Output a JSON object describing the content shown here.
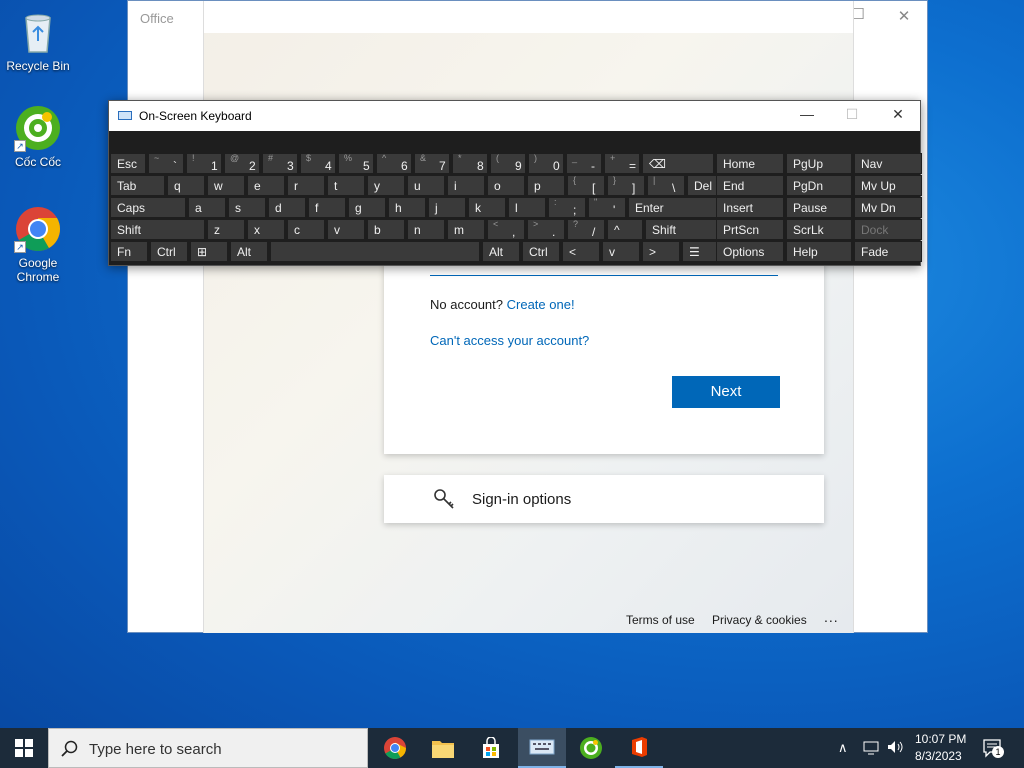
{
  "desktop": {
    "icons": [
      {
        "name": "Recycle Bin"
      },
      {
        "name": "Cốc Cốc"
      },
      {
        "name": "Google Chrome"
      }
    ]
  },
  "office": {
    "title": "Office",
    "no_account_text": "No account?",
    "create_link": "Create one!",
    "cant_access": "Can't access your account?",
    "next_label": "Next",
    "signin_options": "Sign-in options",
    "footer": {
      "terms": "Terms of use",
      "privacy": "Privacy & cookies",
      "more": "..."
    }
  },
  "osk": {
    "title": "On-Screen Keyboard",
    "rows": [
      [
        {
          "m": "Esc",
          "w": 36
        },
        {
          "s": "~",
          "b": "`",
          "w": 36
        },
        {
          "s": "!",
          "b": "1",
          "w": 36
        },
        {
          "s": "@",
          "b": "2",
          "w": 36
        },
        {
          "s": "#",
          "b": "3",
          "w": 36
        },
        {
          "s": "$",
          "b": "4",
          "w": 36
        },
        {
          "s": "%",
          "b": "5",
          "w": 36
        },
        {
          "s": "^",
          "b": "6",
          "w": 36
        },
        {
          "s": "&",
          "b": "7",
          "w": 36
        },
        {
          "s": "*",
          "b": "8",
          "w": 36
        },
        {
          "s": "(",
          "b": "9",
          "w": 36
        },
        {
          "s": ")",
          "b": "0",
          "w": 36
        },
        {
          "s": "_",
          "b": "-",
          "w": 36
        },
        {
          "s": "+",
          "b": "=",
          "w": 36
        },
        {
          "m": "⌫",
          "w": 72
        }
      ],
      [
        {
          "m": "Tab",
          "w": 55
        },
        {
          "m": "q",
          "w": 38
        },
        {
          "m": "w",
          "w": 38
        },
        {
          "m": "e",
          "w": 38
        },
        {
          "m": "r",
          "w": 38
        },
        {
          "m": "t",
          "w": 38
        },
        {
          "m": "y",
          "w": 38
        },
        {
          "m": "u",
          "w": 38
        },
        {
          "m": "i",
          "w": 38
        },
        {
          "m": "o",
          "w": 38
        },
        {
          "m": "p",
          "w": 38
        },
        {
          "s": "{",
          "b": "[",
          "w": 38
        },
        {
          "s": "}",
          "b": "]",
          "w": 38
        },
        {
          "s": "|",
          "b": "\\",
          "w": 38
        },
        {
          "m": "Del",
          "w": 46
        }
      ],
      [
        {
          "m": "Caps",
          "w": 76
        },
        {
          "m": "a",
          "w": 38
        },
        {
          "m": "s",
          "w": 38
        },
        {
          "m": "d",
          "w": 38
        },
        {
          "m": "f",
          "w": 38
        },
        {
          "m": "g",
          "w": 38
        },
        {
          "m": "h",
          "w": 38
        },
        {
          "m": "j",
          "w": 38
        },
        {
          "m": "k",
          "w": 38
        },
        {
          "m": "l",
          "w": 38
        },
        {
          "s": ":",
          "b": ";",
          "w": 38
        },
        {
          "s": "\"",
          "b": "'",
          "w": 38
        },
        {
          "m": "Enter",
          "w": 104
        }
      ],
      [
        {
          "m": "Shift",
          "w": 95
        },
        {
          "m": "z",
          "w": 38
        },
        {
          "m": "x",
          "w": 38
        },
        {
          "m": "c",
          "w": 38
        },
        {
          "m": "v",
          "w": 38
        },
        {
          "m": "b",
          "w": 38
        },
        {
          "m": "n",
          "w": 38
        },
        {
          "m": "m",
          "w": 38
        },
        {
          "s": "<",
          "b": ",",
          "w": 38
        },
        {
          "s": ">",
          "b": ".",
          "w": 38
        },
        {
          "s": "?",
          "b": "/",
          "w": 38
        },
        {
          "m": "^",
          "w": 36
        },
        {
          "m": "Shift",
          "w": 88
        }
      ],
      [
        {
          "m": "Fn",
          "w": 38
        },
        {
          "m": "Ctrl",
          "w": 38
        },
        {
          "m": "⊞",
          "w": 38
        },
        {
          "m": "Alt",
          "w": 38
        },
        {
          "m": "",
          "w": 210
        },
        {
          "m": "Alt",
          "w": 38
        },
        {
          "m": "Ctrl",
          "w": 38
        },
        {
          "m": "<",
          "w": 38
        },
        {
          "m": "v",
          "w": 38
        },
        {
          "m": ">",
          "w": 38
        },
        {
          "m": "☰",
          "w": 38
        }
      ]
    ],
    "nav_keys": [
      [
        "Home",
        "PgUp",
        "Nav"
      ],
      [
        "End",
        "PgDn",
        "Mv Up"
      ],
      [
        "Insert",
        "Pause",
        "Mv Dn"
      ],
      [
        "PrtScn",
        "ScrLk",
        "Dock"
      ],
      [
        "Options",
        "Help",
        "Fade"
      ]
    ]
  },
  "taskbar": {
    "search_placeholder": "Type here to search",
    "time": "10:07 PM",
    "date": "8/3/2023",
    "notif_count": "1"
  }
}
